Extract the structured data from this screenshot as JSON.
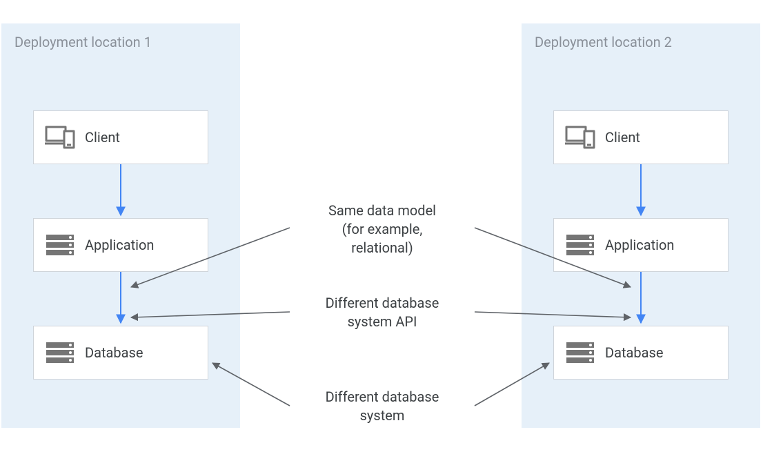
{
  "regions": {
    "left_title": "Deployment location 1",
    "right_title": "Deployment location 2"
  },
  "nodes": {
    "client": "Client",
    "application": "Application",
    "database": "Database"
  },
  "annotations": {
    "same_model": "Same data model\n(for example,\nrelational)",
    "diff_api": "Different database\nsystem API",
    "diff_system": "Different database\nsystem"
  },
  "colors": {
    "region_bg": "#e6f0f9",
    "region_title": "#8a9099",
    "node_border": "#cfd4da",
    "text": "#3c4043",
    "icon": "#757575",
    "blue_arrow": "#4285f4",
    "gray_arrow": "#5f6368"
  }
}
